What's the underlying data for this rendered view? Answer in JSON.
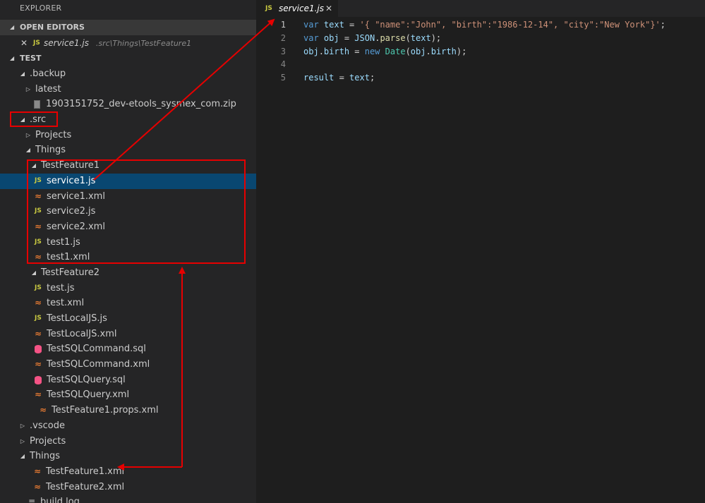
{
  "explorer": {
    "title": "EXPLORER",
    "open_editors": {
      "header": "OPEN EDITORS",
      "items": [
        {
          "name": "service1.js",
          "path": ".src\\Things\\TestFeature1",
          "icon": "JS"
        }
      ]
    },
    "workspace_header": "TEST",
    "tree": [
      {
        "label": ".backup",
        "depth": 1,
        "twisty": "open",
        "icon": "none"
      },
      {
        "label": "latest",
        "depth": 2,
        "twisty": "closed",
        "icon": "none"
      },
      {
        "label": "1903151752_dev-etools_sysmex_com.zip",
        "depth": 2,
        "twisty": "none",
        "icon": "zip"
      },
      {
        "label": ".src",
        "depth": 1,
        "twisty": "open",
        "icon": "none"
      },
      {
        "label": "Projects",
        "depth": 2,
        "twisty": "closed",
        "icon": "none"
      },
      {
        "label": "Things",
        "depth": 2,
        "twisty": "open",
        "icon": "none"
      },
      {
        "label": "TestFeature1",
        "depth": 3,
        "twisty": "open",
        "icon": "none"
      },
      {
        "label": "service1.js",
        "depth": 4,
        "twisty": "none",
        "icon": "js",
        "selected": true
      },
      {
        "label": "service1.xml",
        "depth": 4,
        "twisty": "none",
        "icon": "xml"
      },
      {
        "label": "service2.js",
        "depth": 4,
        "twisty": "none",
        "icon": "js"
      },
      {
        "label": "service2.xml",
        "depth": 4,
        "twisty": "none",
        "icon": "xml"
      },
      {
        "label": "test1.js",
        "depth": 4,
        "twisty": "none",
        "icon": "js"
      },
      {
        "label": "test1.xml",
        "depth": 4,
        "twisty": "none",
        "icon": "xml"
      },
      {
        "label": "TestFeature2",
        "depth": 3,
        "twisty": "open",
        "icon": "none"
      },
      {
        "label": "test.js",
        "depth": 4,
        "twisty": "none",
        "icon": "js"
      },
      {
        "label": "test.xml",
        "depth": 4,
        "twisty": "none",
        "icon": "xml"
      },
      {
        "label": "TestLocalJS.js",
        "depth": 4,
        "twisty": "none",
        "icon": "js"
      },
      {
        "label": "TestLocalJS.xml",
        "depth": 4,
        "twisty": "none",
        "icon": "xml"
      },
      {
        "label": "TestSQLCommand.sql",
        "depth": 4,
        "twisty": "none",
        "icon": "sql"
      },
      {
        "label": "TestSQLCommand.xml",
        "depth": 4,
        "twisty": "none",
        "icon": "xml"
      },
      {
        "label": "TestSQLQuery.sql",
        "depth": 4,
        "twisty": "none",
        "icon": "sql"
      },
      {
        "label": "TestSQLQuery.xml",
        "depth": 4,
        "twisty": "none",
        "icon": "xml"
      },
      {
        "label": "TestFeature1.props.xml",
        "depth": 3,
        "twisty": "none",
        "icon": "xml"
      },
      {
        "label": ".vscode",
        "depth": 1,
        "twisty": "closed",
        "icon": "none"
      },
      {
        "label": "Projects",
        "depth": 1,
        "twisty": "closed",
        "icon": "none"
      },
      {
        "label": "Things",
        "depth": 1,
        "twisty": "open",
        "icon": "none"
      },
      {
        "label": "TestFeature1.xml",
        "depth": 2,
        "twisty": "none",
        "icon": "xml"
      },
      {
        "label": "TestFeature2.xml",
        "depth": 2,
        "twisty": "none",
        "icon": "xml"
      },
      {
        "label": "build.log",
        "depth": 1,
        "twisty": "none",
        "icon": "log"
      }
    ]
  },
  "editor": {
    "tab": {
      "name": "service1.js",
      "icon": "JS",
      "close": "✕"
    },
    "active_line": 1,
    "lines": [
      {
        "n": "1",
        "tokens": [
          {
            "t": "var",
            "c": "kw"
          },
          {
            "t": " ",
            "c": ""
          },
          {
            "t": "text",
            "c": "var"
          },
          {
            "t": " = ",
            "c": ""
          },
          {
            "t": "'{ \"name\":\"John\", \"birth\":\"1986-12-14\", \"city\":\"New York\"}'",
            "c": "str"
          },
          {
            "t": ";",
            "c": ""
          }
        ]
      },
      {
        "n": "2",
        "tokens": [
          {
            "t": "var",
            "c": "kw"
          },
          {
            "t": " ",
            "c": ""
          },
          {
            "t": "obj",
            "c": "var"
          },
          {
            "t": " = ",
            "c": ""
          },
          {
            "t": "JSON",
            "c": "var"
          },
          {
            "t": ".",
            "c": ""
          },
          {
            "t": "parse",
            "c": "fn"
          },
          {
            "t": "(",
            "c": ""
          },
          {
            "t": "text",
            "c": "var"
          },
          {
            "t": ");",
            "c": ""
          }
        ]
      },
      {
        "n": "3",
        "tokens": [
          {
            "t": "obj",
            "c": "var"
          },
          {
            "t": ".",
            "c": ""
          },
          {
            "t": "birth",
            "c": "var"
          },
          {
            "t": " = ",
            "c": ""
          },
          {
            "t": "new",
            "c": "kw"
          },
          {
            "t": " ",
            "c": ""
          },
          {
            "t": "Date",
            "c": "cls"
          },
          {
            "t": "(",
            "c": ""
          },
          {
            "t": "obj",
            "c": "var"
          },
          {
            "t": ".",
            "c": ""
          },
          {
            "t": "birth",
            "c": "var"
          },
          {
            "t": ");",
            "c": ""
          }
        ]
      },
      {
        "n": "4",
        "tokens": []
      },
      {
        "n": "5",
        "tokens": [
          {
            "t": "result",
            "c": "var"
          },
          {
            "t": " = ",
            "c": ""
          },
          {
            "t": "text",
            "c": "var"
          },
          {
            "t": ";",
            "c": ""
          }
        ]
      }
    ]
  },
  "colors": {
    "selection": "#094771",
    "annotation": "#e60000",
    "js_icon": "#cbcb41",
    "xml_icon": "#e37933",
    "sql_icon": "#f55385"
  },
  "icons": {
    "close": "close-icon",
    "open_twisty": "chevron-down-icon",
    "closed_twisty": "chevron-right-icon",
    "js": "javascript-file-icon",
    "xml": "xml-rss-file-icon",
    "sql": "database-file-icon",
    "zip": "zip-file-icon",
    "log": "log-file-icon"
  }
}
